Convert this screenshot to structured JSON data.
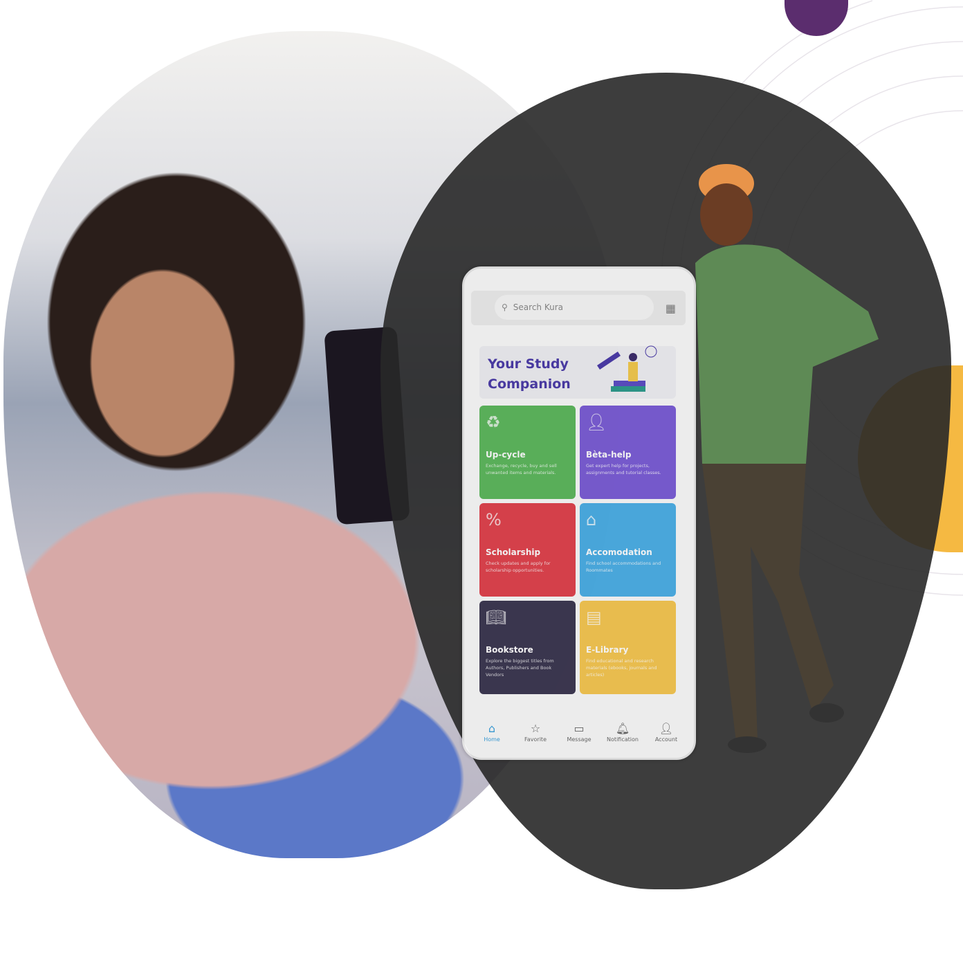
{
  "colors": {
    "purple_dot": "#5b2d6e",
    "orange": "#f5b942",
    "dark_blob": "#3a3a3a"
  },
  "phone": {
    "search": {
      "placeholder": "Search Kura",
      "icon": "search-icon",
      "qr_icon": "qr-code-icon"
    },
    "banner": {
      "title_line1": "Your Study",
      "title_line2": "Companion"
    },
    "tiles": [
      {
        "title": "Up-cycle",
        "desc": "Exchange, recycle, buy and sell unwanted items and materials.",
        "color": "#5cb85c",
        "icon": "recycle-icon"
      },
      {
        "title": "Bèta-help",
        "desc": "Get expert help for projects, assignments and tutorial classes.",
        "color": "#7a5cd6",
        "icon": "person-icon"
      },
      {
        "title": "Scholarship",
        "desc": "Check updates and apply for scholarship opportunities.",
        "color": "#e0414c",
        "icon": "percent-icon"
      },
      {
        "title": "Accomodation",
        "desc": "Find school accommodations and Roommates",
        "color": "#4aaee6",
        "icon": "house-icon"
      },
      {
        "title": "Bookstore",
        "desc": "Explore the biggest titles from Authors, Publishers and Book Vendors",
        "color": "#3b3650",
        "icon": "book-icon"
      },
      {
        "title": "E-Library",
        "desc": "Find educational and research materials (ebooks, journals and articles)",
        "color": "#f6c650",
        "icon": "library-icon"
      }
    ],
    "nav": [
      {
        "label": "Home",
        "icon": "home-icon",
        "glyph": "⌂"
      },
      {
        "label": "Favorite",
        "icon": "star-icon",
        "glyph": "☆"
      },
      {
        "label": "Message",
        "icon": "message-icon",
        "glyph": "▭"
      },
      {
        "label": "Notification",
        "icon": "bell-icon",
        "glyph": "🔔︎"
      },
      {
        "label": "Account",
        "icon": "user-icon",
        "glyph": "👤︎"
      }
    ]
  }
}
